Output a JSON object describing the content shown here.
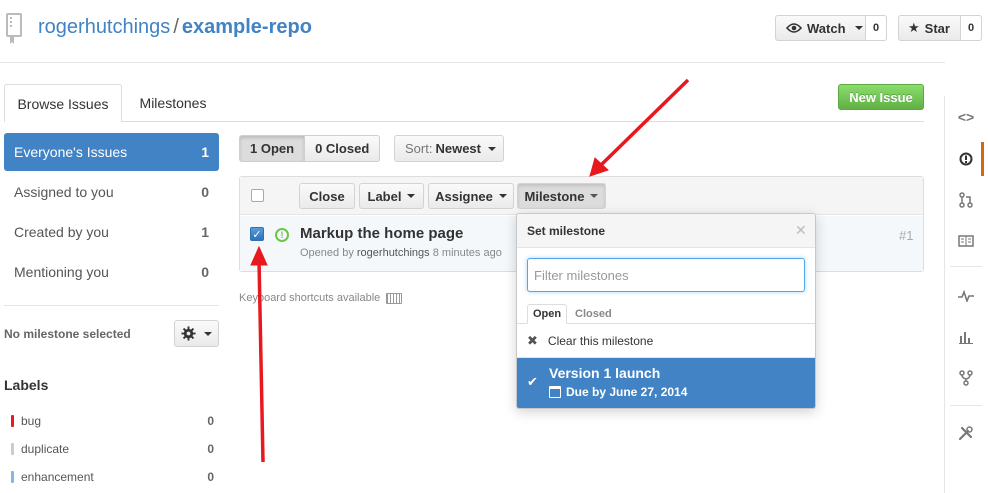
{
  "repo": {
    "owner": "rogerhutchings",
    "separator": "/",
    "name": "example-repo"
  },
  "header": {
    "watch": {
      "label": "Watch",
      "count": "0"
    },
    "star": {
      "label": "Star",
      "count": "0"
    }
  },
  "tabs": {
    "browse": "Browse Issues",
    "milestones": "Milestones"
  },
  "new_issue_label": "New Issue",
  "filters": [
    {
      "label": "Everyone's Issues",
      "count": "1",
      "selected": true
    },
    {
      "label": "Assigned to you",
      "count": "0"
    },
    {
      "label": "Created by you",
      "count": "1"
    },
    {
      "label": "Mentioning you",
      "count": "0"
    }
  ],
  "milestone_filter": {
    "label": "No milestone selected"
  },
  "labels": {
    "title": "Labels",
    "items": [
      {
        "name": "bug",
        "count": "0",
        "color": "#e11d21"
      },
      {
        "name": "duplicate",
        "count": "0",
        "color": "#cccccc"
      },
      {
        "name": "enhancement",
        "count": "0",
        "color": "#84b6eb"
      }
    ]
  },
  "state": {
    "open": "1 Open",
    "closed": "0 Closed"
  },
  "sort": {
    "prefix": "Sort:",
    "value": "Newest"
  },
  "toolbar": {
    "close": "Close",
    "label": "Label",
    "assignee": "Assignee",
    "milestone": "Milestone"
  },
  "issue": {
    "title": "Markup the home page",
    "opened_prefix": "Opened by",
    "author": "rogerhutchings",
    "time": "8 minutes ago",
    "number": "#1"
  },
  "keyboard_hint": "Keyboard shortcuts available",
  "milestone_popup": {
    "title": "Set milestone",
    "filter_placeholder": "Filter milestones",
    "tabs": {
      "open": "Open",
      "closed": "Closed"
    },
    "clear": "Clear this milestone",
    "items": [
      {
        "title": "Version 1 launch",
        "due": "Due by June 27, 2014",
        "selected": true
      }
    ]
  },
  "colors": {
    "accent": "#4183c4",
    "new_issue": "#60b044",
    "annotation_arrow": "#e8191e",
    "rail_active": "#d26911"
  },
  "rail_icons": [
    "code-icon",
    "issues-icon",
    "pull-request-icon",
    "wiki-icon",
    "pulse-icon",
    "graphs-icon",
    "network-icon",
    "settings-icon"
  ]
}
